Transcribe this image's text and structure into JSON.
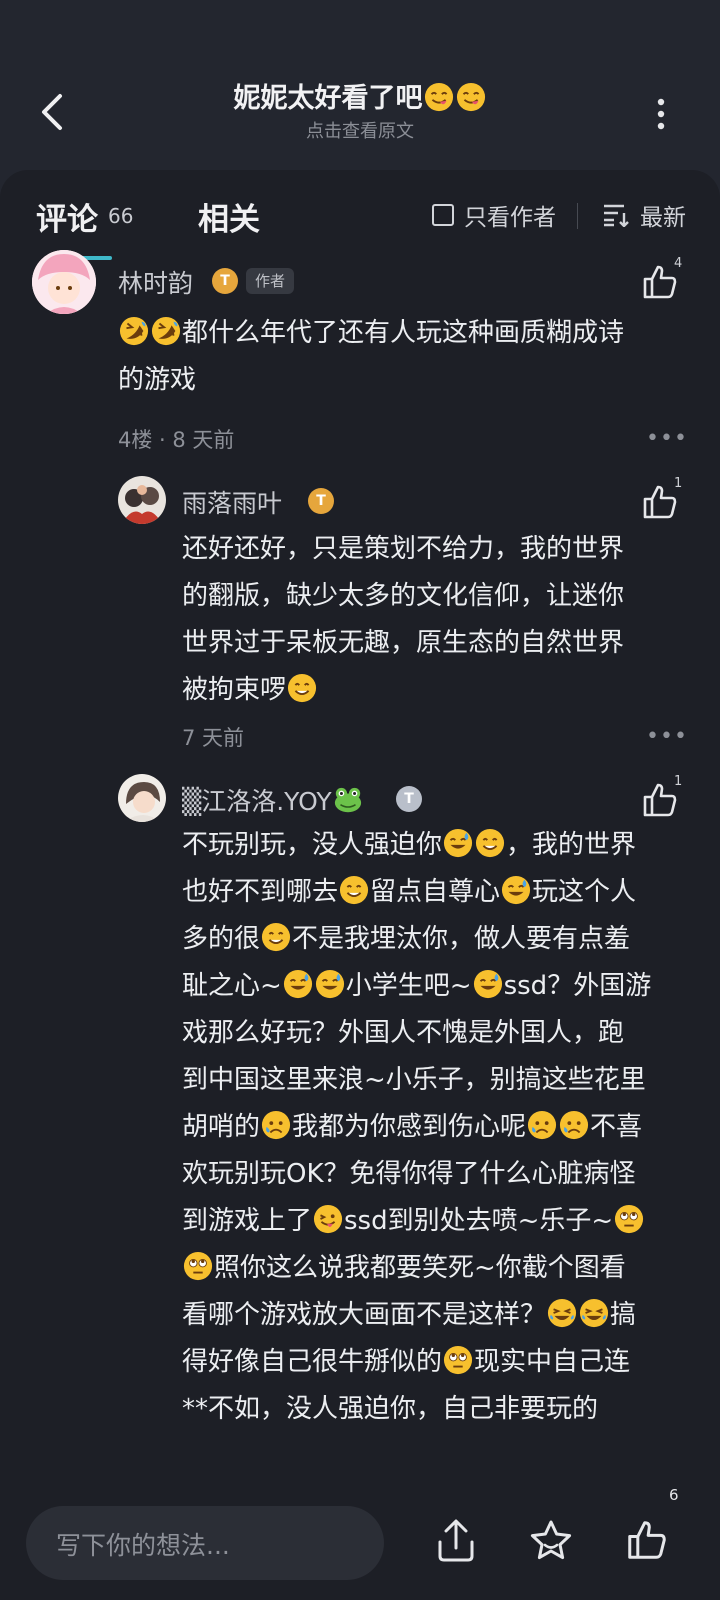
{
  "header": {
    "title": "妮妮太好看了吧",
    "subtitle": "点击查看原文"
  },
  "tabs": {
    "comments_label": "评论",
    "comments_count": "66",
    "related_label": "相关",
    "author_only_label": "只看作者",
    "sort_label": "最新"
  },
  "comment": {
    "username": "林时韵",
    "level_badge": "T",
    "author_badge": "作者",
    "like_count": "4",
    "text": "都什么年代了还有人玩这种画质糊成诗的游戏",
    "meta": "4楼 · 8 天前",
    "more": "•••"
  },
  "replies": [
    {
      "username": "雨落雨叶",
      "level_badge": "T",
      "like_count": "1",
      "text": "还好还好，只是策划不给力，我的世界的翻版，缺少太多的文化信仰，让迷你世界过于呆板无趣，原生态的自然世界被拘束啰",
      "meta": "7 天前",
      "more": "•••"
    },
    {
      "username": "▒江洛洛.YOY",
      "level_badge": "T",
      "like_count": "1",
      "text": "不玩别玩，没人强迫你，我的世界也好不到哪去留点自尊心玩这个人多的很不是我埋汰你，做人要有点羞耻之心~~小学生吧~ssd？外国游戏那么好玩？外国人不愧是外国人，跑到中国这里来浪~小乐子，别搞这些花里胡哨的我都为你感到伤心呢不喜欢玩别玩OK？免得你得了什么心脏病怪到游戏上了ssd到别处去喷~乐子~照你这么说我都要笑死~你截个图看看哪个游戏放大画面不是这样？搞得好像自己很牛掰似的现实中自己连**不如，没人强迫你，自己非要玩的"
    }
  ],
  "reply_lines": [
    [
      "还好还好，只是策划不给力，我的世界",
      "的翻版，缺少太多的文化信仰，让迷你",
      "世界过于呆板无趣，原生态的自然世界",
      "被拘束啰"
    ],
    [
      "不玩别玩，没人强迫你",
      "，我的世界",
      "也好不到哪去",
      "留点自尊心",
      "玩这个人",
      "多的很",
      "不是我埋汰你，做人要有点羞",
      "耻之心~",
      "小学生吧~",
      "ssd？外国游",
      "戏那么好玩？外国人不愧是外国人，跑",
      "到中国这里来浪~小乐子，别搞这些花里",
      "胡哨的",
      "我都为你感到伤心呢",
      "不喜",
      "欢玩别玩OK？免得你得了什么心脏病怪",
      "到游戏上了",
      "ssd到别处去喷~乐子~",
      "照你这么说我都要笑死~你截个图看",
      "看哪个游戏放大画面不是这样？",
      "搞",
      "得好像自己很牛掰似的",
      "现实中自己连",
      "**不如，没人强迫你，自己非要玩的"
    ]
  ],
  "comment_lines": [
    "都什么年代了还有人玩这种画质糊成诗",
    "的游戏"
  ],
  "bottom_bar": {
    "input_placeholder": "写下你的想法...",
    "like_count": "6"
  },
  "icons": [
    "back-arrow-icon",
    "more-vertical-icon",
    "checkbox-icon",
    "sort-lines-icon",
    "thumbs-up-icon",
    "share-icon",
    "star-icon",
    "emoji-icon",
    "frog-emoji-icon"
  ],
  "colors": {
    "background": "#1d1f26",
    "accent": "#3fb8c9",
    "level_gold": "#e6a63c"
  }
}
